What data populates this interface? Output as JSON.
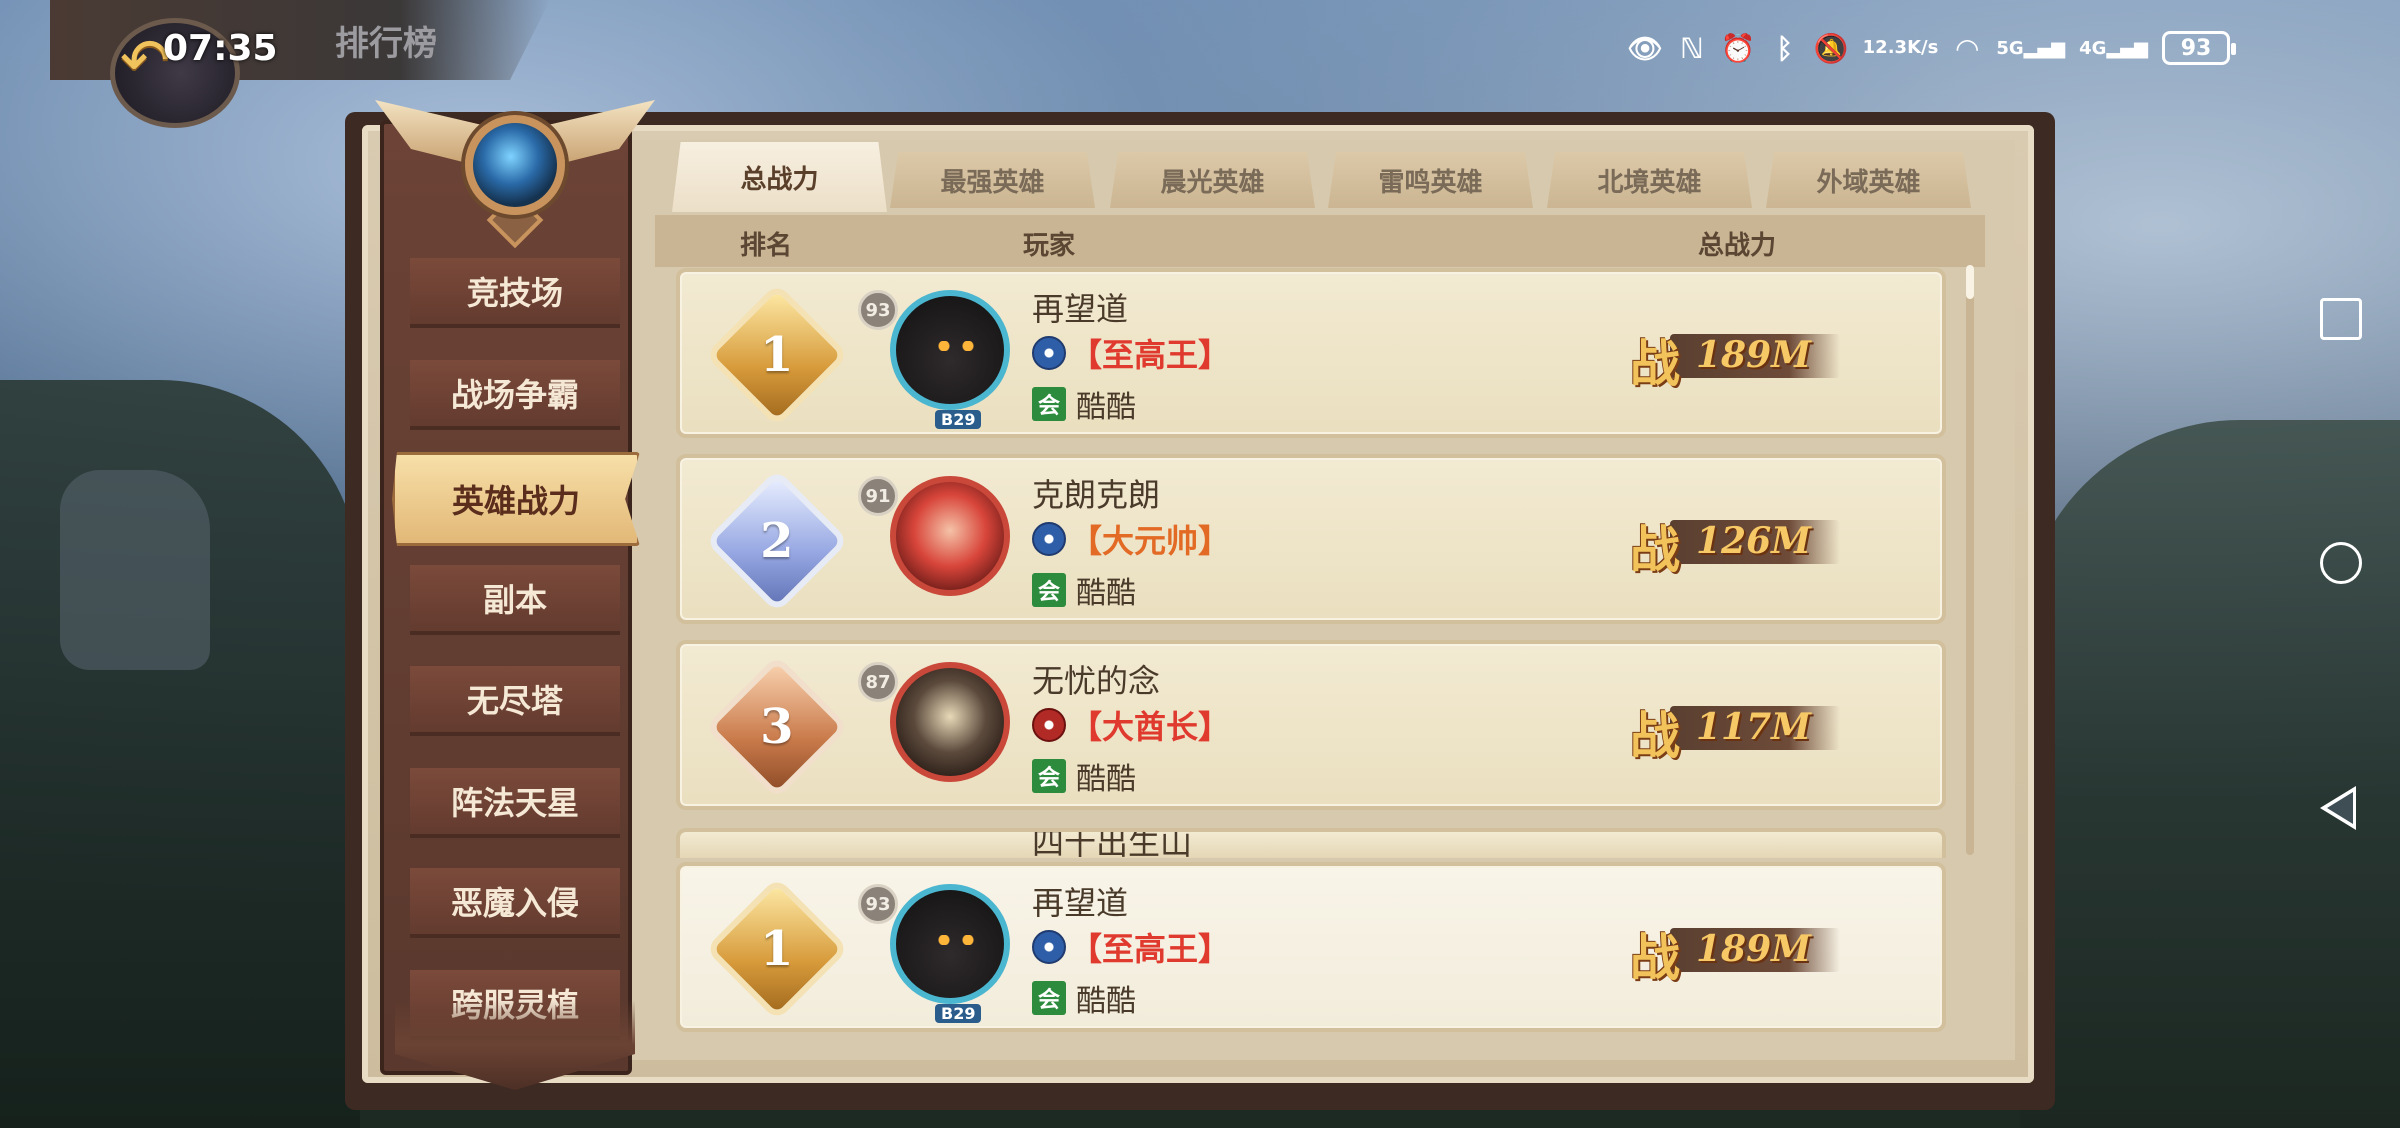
{
  "status_bar": {
    "clock": "07:35",
    "speed_value": "12.3",
    "speed_unit": "K/s",
    "net1": "5G",
    "net2": "4G",
    "battery": "93"
  },
  "header": {
    "title": "排行榜",
    "back_icon": "back-arrow-icon"
  },
  "sidebar": {
    "items": [
      {
        "label": "竞技场",
        "active": false
      },
      {
        "label": "战场争霸",
        "active": false
      },
      {
        "label": "英雄战力",
        "active": true
      },
      {
        "label": "副本",
        "active": false
      },
      {
        "label": "无尽塔",
        "active": false
      },
      {
        "label": "阵法天星",
        "active": false
      },
      {
        "label": "恶魔入侵",
        "active": false
      },
      {
        "label": "跨服灵植",
        "active": false
      }
    ]
  },
  "tabs": [
    {
      "label": "总战力",
      "active": true
    },
    {
      "label": "最强英雄",
      "active": false
    },
    {
      "label": "晨光英雄",
      "active": false
    },
    {
      "label": "雷鸣英雄",
      "active": false
    },
    {
      "label": "北境英雄",
      "active": false
    },
    {
      "label": "外域英雄",
      "active": false
    }
  ],
  "list_header": {
    "rank": "排名",
    "player": "玩家",
    "power": "总战力"
  },
  "power_prefix": "战",
  "rows": [
    {
      "rank": "1",
      "level": "93",
      "name": "再望道",
      "title": "【至高王】",
      "guild_tag": "会",
      "guild": "酷酷",
      "power": "189M",
      "avatar_tag": "B29"
    },
    {
      "rank": "2",
      "level": "91",
      "name": "克朗克朗",
      "title": "【大元帅】",
      "guild_tag": "会",
      "guild": "酷酷",
      "power": "126M"
    },
    {
      "rank": "3",
      "level": "87",
      "name": "无忧的念",
      "title": "【大酋长】",
      "guild_tag": "会",
      "guild": "酷酷",
      "power": "117M"
    }
  ],
  "partial_row_name": "四十出生山",
  "my_row": {
    "rank": "1",
    "level": "93",
    "name": "再望道",
    "title": "【至高王】",
    "guild_tag": "会",
    "guild": "酷酷",
    "power": "189M",
    "avatar_tag": "B29"
  }
}
